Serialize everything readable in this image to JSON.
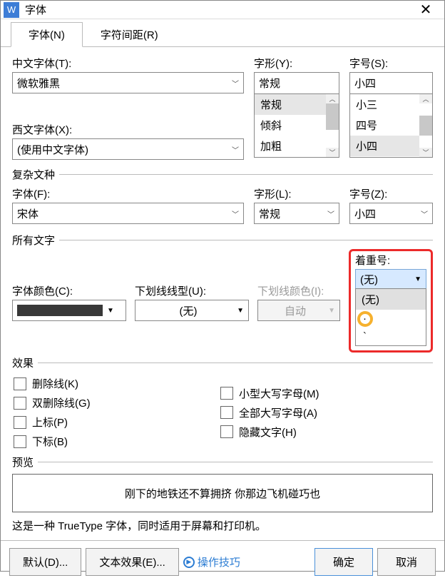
{
  "title": "字体",
  "tabs": {
    "font": "字体(N)",
    "spacing": "字符间距(R)"
  },
  "labels": {
    "cjk_font": "中文字体(T):",
    "latin_font": "西文字体(X):",
    "style": "字形(Y):",
    "size": "字号(S):",
    "complex_group": "复杂文种",
    "cx_font": "字体(F):",
    "cx_style": "字形(L):",
    "cx_size": "字号(Z):",
    "all_text_group": "所有文字",
    "font_color": "字体颜色(C):",
    "underline_type": "下划线线型(U):",
    "underline_color": "下划线颜色(I):",
    "emphasis": "着重号:",
    "effects_group": "效果",
    "preview_group": "预览"
  },
  "values": {
    "cjk_font": "微软雅黑",
    "latin_font": "(使用中文字体)",
    "style_input": "常规",
    "size_input": "小四",
    "cx_font": "宋体",
    "cx_style": "常规",
    "cx_size": "小四",
    "underline_type": "(无)",
    "underline_color": "自动",
    "emphasis": "(无)"
  },
  "style_options": [
    "常规",
    "倾斜",
    "加粗"
  ],
  "size_options": [
    "小三",
    "四号",
    "小四"
  ],
  "emphasis_options": [
    "(无)",
    "",
    ""
  ],
  "effects": {
    "strike": "删除线(K)",
    "dblstrike": "双删除线(G)",
    "superscript": "上标(P)",
    "subscript": "下标(B)",
    "smallcaps": "小型大写字母(M)",
    "allcaps": "全部大写字母(A)",
    "hidden": "隐藏文字(H)"
  },
  "preview_text": "刚下的地铁还不算拥挤   你那边飞机碰巧也",
  "note": "这是一种 TrueType 字体，同时适用于屏幕和打印机。",
  "buttons": {
    "default": "默认(D)...",
    "text_effect": "文本效果(E)...",
    "tips": "操作技巧",
    "ok": "确定",
    "cancel": "取消"
  }
}
